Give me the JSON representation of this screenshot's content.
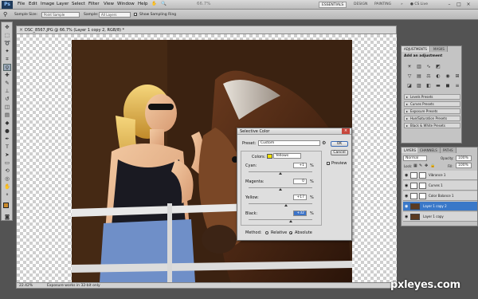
{
  "menubar": {
    "logo": "Ps",
    "items": [
      "File",
      "Edit",
      "Image",
      "Layer",
      "Select",
      "Filter",
      "View",
      "Window",
      "Help"
    ],
    "zoom": "66.7%",
    "workspaces": [
      "ESSENTIALS",
      "DESIGN",
      "PAINTING"
    ],
    "cs_live": "CS Live"
  },
  "options": {
    "sample_size_label": "Sample Size:",
    "sample_size_value": "Point Sample",
    "sample_label": "Sample:",
    "sample_value": "All Layers",
    "show_ring": "Show Sampling Ring"
  },
  "document": {
    "tab_title": "DSC_8567.JPG @ 66.7% (Layer 1 copy 2, RGB/8) *",
    "zoom": "22.42%",
    "status": "Exposure works in 32-bit only"
  },
  "dialog": {
    "title": "Selective Color",
    "preset_label": "Preset:",
    "preset_value": "Custom",
    "colors_label": "Colors:",
    "colors_value": "Yellows",
    "swatch_color": "#f2e200",
    "channels": [
      {
        "label": "Cyan:",
        "value": "+1",
        "unit": "%",
        "level": 0.505
      },
      {
        "label": "Magenta:",
        "value": "0",
        "unit": "%",
        "level": 0.5
      },
      {
        "label": "Yellow:",
        "value": "+17",
        "unit": "%",
        "level": 0.585
      },
      {
        "label": "Black:",
        "value": "+32",
        "unit": "%",
        "level": 0.66
      }
    ],
    "method_label": "Method:",
    "method_options": [
      "Relative",
      "Absolute"
    ],
    "method_selected": "Absolute",
    "ok": "OK",
    "cancel": "Cancel",
    "preview": "Preview"
  },
  "adjustments": {
    "tabs": [
      "ADJUSTMENTS",
      "MASKS"
    ],
    "heading": "Add an adjustment",
    "presets": [
      "Levels Presets",
      "Curves Presets",
      "Exposure Presets",
      "Hue/Saturation Presets",
      "Black & White Presets"
    ]
  },
  "layers": {
    "tabs": [
      "LAYERS",
      "CHANNELS",
      "PATHS"
    ],
    "blend_mode": "Normal",
    "opacity_label": "Opacity:",
    "opacity": "100%",
    "lock_label": "Lock:",
    "fill_label": "Fill:",
    "fill": "100%",
    "rows": [
      {
        "name": "Vibrance 1"
      },
      {
        "name": "Curves 1"
      },
      {
        "name": "Color Balance 1"
      },
      {
        "name": "Layer 1 copy 2"
      },
      {
        "name": "Layer 1 copy"
      }
    ]
  },
  "colors": {
    "accent": "#3a78c8",
    "foreground": "#c98a2c",
    "background": "#ffffff"
  },
  "watermark": "pxleyes.com"
}
